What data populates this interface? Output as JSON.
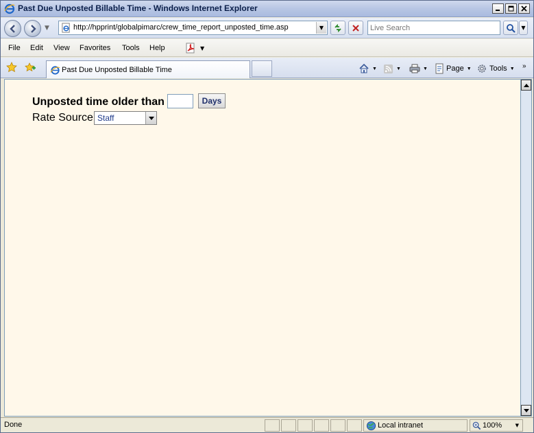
{
  "window": {
    "title": "Past Due Unposted Billable Time - Windows Internet Explorer",
    "minimize_glyph": "0",
    "maximize_glyph": "1",
    "close_glyph": "x"
  },
  "navbar": {
    "address": "http://hpprint/globalpimarc/crew_time_report_unposted_time.asp",
    "search_placeholder": "Live Search"
  },
  "menubar": {
    "items": [
      "File",
      "Edit",
      "View",
      "Favorites",
      "Tools",
      "Help"
    ]
  },
  "tabs": {
    "active_label": "Past Due Unposted Billable Time"
  },
  "commandbar": {
    "page_label": "Page",
    "tools_label": "Tools"
  },
  "form": {
    "unposted_label": "Unposted time older than",
    "days_value": "",
    "days_button": "Days",
    "rate_source_label": "Rate Source",
    "rate_source_value": "Staff"
  },
  "statusbar": {
    "status": "Done",
    "zone": "Local intranet",
    "zoom": "100%"
  },
  "colors": {
    "content_bg": "#fff8ea",
    "titlebar": "#b8c6e4",
    "select_text": "#1f3a8a"
  },
  "icons": {
    "window": "ie-logo-icon",
    "back": "back-arrow-icon",
    "forward": "forward-arrow-icon",
    "refresh": "refresh-icon",
    "stop": "stop-icon",
    "search": "magnifier-icon",
    "favorites": "star-icon",
    "add_favorites": "add-favorite-icon",
    "home": "home-icon",
    "feeds": "feed-icon",
    "print": "printer-icon",
    "page": "page-icon",
    "tools": "gear-icon",
    "pdf": "pdf-icon",
    "zone": "globe-icon",
    "zoom": "zoom-magnifier-icon"
  }
}
